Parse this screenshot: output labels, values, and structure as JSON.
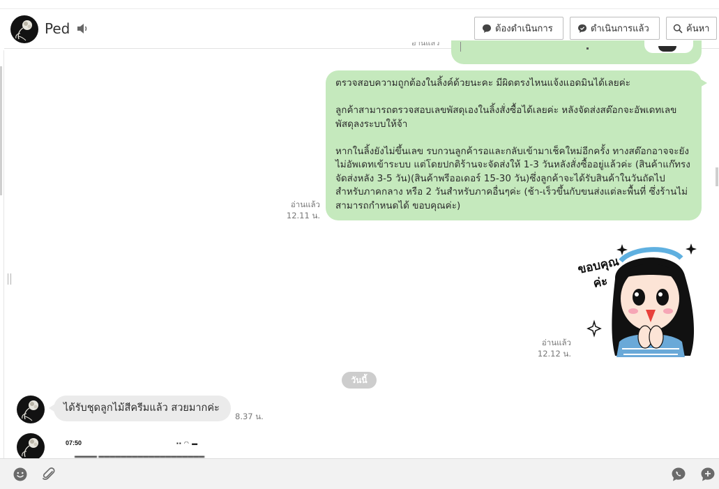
{
  "header": {
    "contact_name": "Ped",
    "buttons": {
      "todo": "ต้องดำเนินการ",
      "done": "ดำเนินการแล้ว",
      "search": "ค้นหา"
    }
  },
  "messages": {
    "outgoing_text": {
      "paragraphs": [
        "ตรวจสอบความถูกต้องในลิ้งค์ด้วยนะคะ มีผิดตรงไหนแจ้งแอดมินได้เลยค่ะ",
        "ลูกค้าสามารถตรวจสอบเลขพัสดุเองในลิ้งสั่งซื้อได้เลยค่ะ หลังจัดส่งสต๊อกจะอัพเดทเลขพัสดุลงระบบให้จ้า",
        "หากในลิ้งยังไม่ขึ้นเลข รบกวนลูกค้ารอและกลับเข้ามาเช็คใหม่อีกครั้ง ทางสต๊อกอาจจะยังไม่อัพเดทเข้าระบบ แต่โดยปกติร้านจะจัดส่งให้ 1-3 วันหลังสั่งซื้ออยู่แล้วค่ะ (สินค้าแก๊ทรงจัดส่งหลัง 3-5 วัน)(สินค้าพรีออเดอร์ 15-30 วัน)ซึ่งลูกค้าจะได้รับสินค้าในวันถัดไปสำหรับภาคกลาง หรือ 2 วันสำหรับภาคอื่นๆค่ะ (ช้า-เร็วขึ้นกับขนส่งแต่ละพื้นที่ ซึ่งร้านไม่สามารถกำหนดได้ ขอบคุณค่ะ)"
      ],
      "read_label": "อ่านแล้ว",
      "time": "12.11 น."
    },
    "outgoing_sticker": {
      "sticker_text_line1": "ขอบคุณ",
      "sticker_text_line2": "ค่ะ",
      "read_label": "อ่านแล้ว",
      "time": "12.12 น."
    },
    "date_separator": "วันนี้",
    "incoming_text": {
      "text": "ได้รับชุดลูกไม้สีครีมแล้ว สวยมากค่ะ",
      "time": "8.37 น."
    },
    "incoming_image": {
      "clock": "07:50"
    }
  },
  "colors": {
    "outgoing_bubble": "#c5e9bd",
    "incoming_bubble": "#ebebeb",
    "date_pill": "#cdcdcd",
    "composer_bg": "#f2f2f2"
  },
  "composer": {
    "icons": [
      "emoji-icon",
      "paperclip-icon",
      "call-icon",
      "add-icon"
    ]
  }
}
